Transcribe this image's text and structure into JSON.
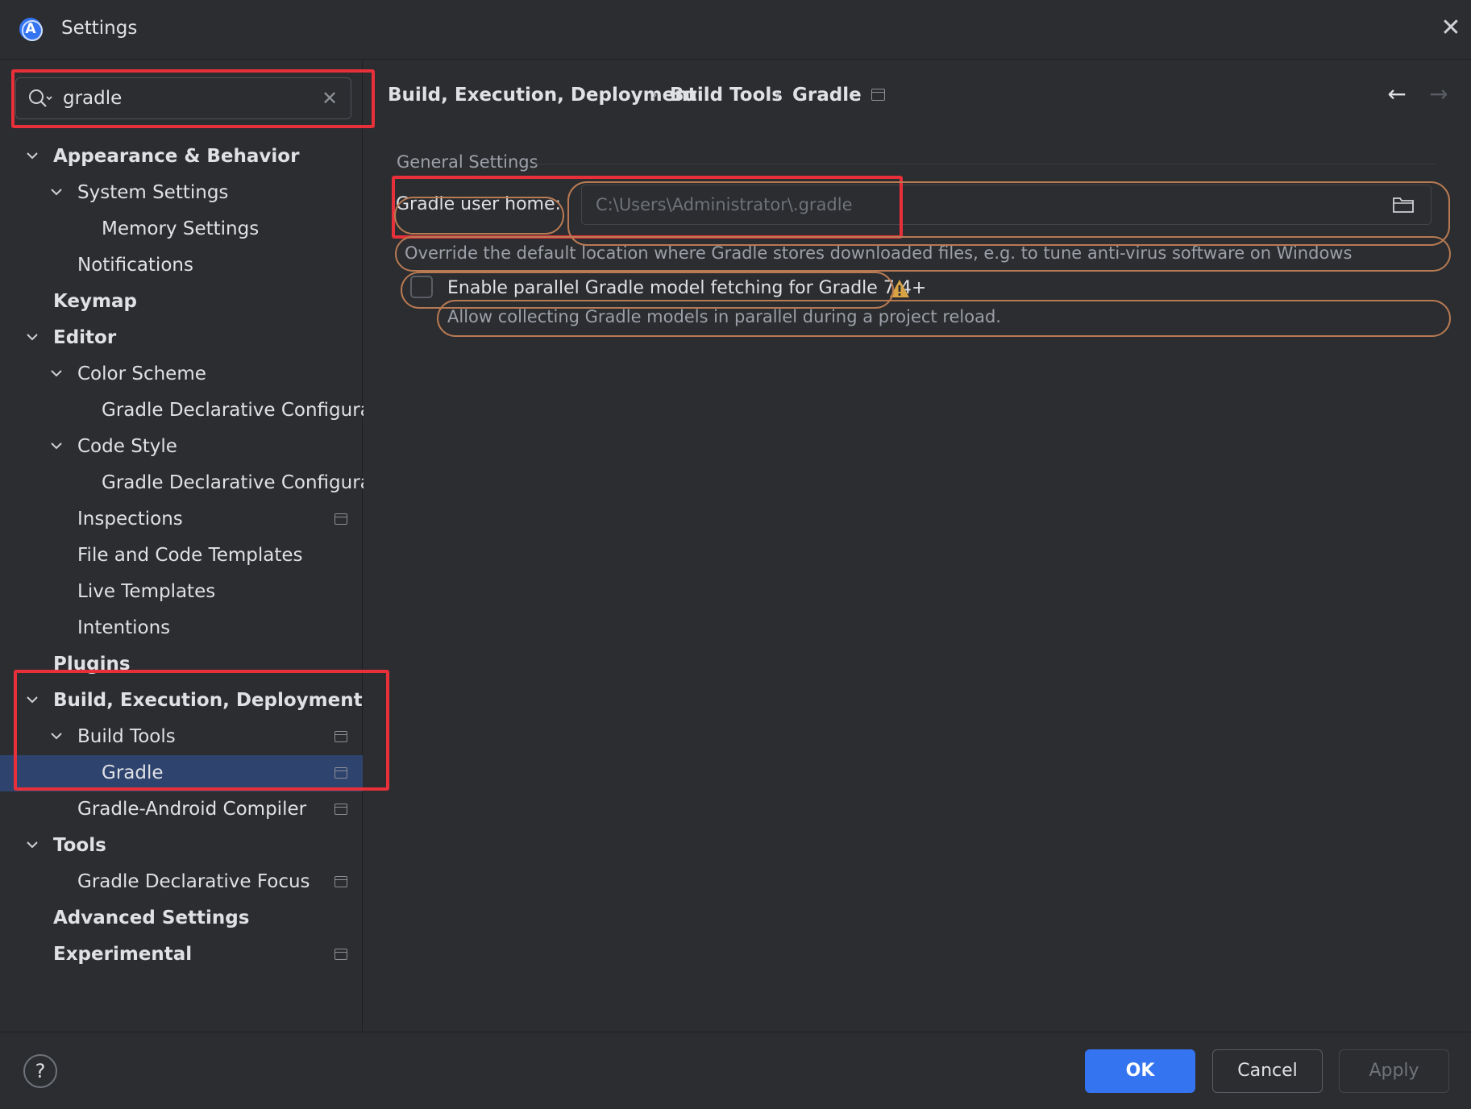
{
  "window": {
    "title": "Settings"
  },
  "search": {
    "value": "gradle"
  },
  "tree": [
    {
      "label": "Appearance & Behavior",
      "level": 0,
      "bold": true,
      "expanded": true,
      "has_chevron": true,
      "page_icon": false,
      "selected": false
    },
    {
      "label": "System Settings",
      "level": 1,
      "bold": false,
      "expanded": true,
      "has_chevron": true,
      "page_icon": false,
      "selected": false
    },
    {
      "label": "Memory Settings",
      "level": 2,
      "bold": false,
      "has_chevron": false,
      "page_icon": false,
      "selected": false
    },
    {
      "label": "Notifications",
      "level": 1,
      "bold": false,
      "has_chevron": false,
      "page_icon": false,
      "selected": false
    },
    {
      "label": "Keymap",
      "level": 0,
      "bold": true,
      "has_chevron": false,
      "page_icon": false,
      "selected": false
    },
    {
      "label": "Editor",
      "level": 0,
      "bold": true,
      "expanded": true,
      "has_chevron": true,
      "page_icon": false,
      "selected": false
    },
    {
      "label": "Color Scheme",
      "level": 1,
      "bold": false,
      "expanded": true,
      "has_chevron": true,
      "page_icon": false,
      "selected": false
    },
    {
      "label": "Gradle Declarative Configurati",
      "level": 2,
      "bold": false,
      "has_chevron": false,
      "page_icon": false,
      "selected": false
    },
    {
      "label": "Code Style",
      "level": 1,
      "bold": false,
      "expanded": true,
      "has_chevron": true,
      "page_icon": false,
      "selected": false
    },
    {
      "label": "Gradle Declarative Configurati",
      "level": 2,
      "bold": false,
      "has_chevron": false,
      "page_icon": false,
      "selected": false
    },
    {
      "label": "Inspections",
      "level": 1,
      "bold": false,
      "has_chevron": false,
      "page_icon": true,
      "selected": false
    },
    {
      "label": "File and Code Templates",
      "level": 1,
      "bold": false,
      "has_chevron": false,
      "page_icon": false,
      "selected": false
    },
    {
      "label": "Live Templates",
      "level": 1,
      "bold": false,
      "has_chevron": false,
      "page_icon": false,
      "selected": false
    },
    {
      "label": "Intentions",
      "level": 1,
      "bold": false,
      "has_chevron": false,
      "page_icon": false,
      "selected": false
    },
    {
      "label": "Plugins",
      "level": 0,
      "bold": true,
      "has_chevron": false,
      "page_icon": false,
      "selected": false
    },
    {
      "label": "Build, Execution, Deployment",
      "level": 0,
      "bold": true,
      "expanded": true,
      "has_chevron": true,
      "page_icon": false,
      "selected": false
    },
    {
      "label": "Build Tools",
      "level": 1,
      "bold": false,
      "expanded": true,
      "has_chevron": true,
      "page_icon": true,
      "selected": false
    },
    {
      "label": "Gradle",
      "level": 2,
      "bold": false,
      "has_chevron": false,
      "page_icon": true,
      "selected": true
    },
    {
      "label": "Gradle-Android Compiler",
      "level": 1,
      "bold": false,
      "has_chevron": false,
      "page_icon": true,
      "selected": false
    },
    {
      "label": "Tools",
      "level": 0,
      "bold": true,
      "expanded": true,
      "has_chevron": true,
      "page_icon": false,
      "selected": false
    },
    {
      "label": "Gradle Declarative Focus",
      "level": 1,
      "bold": false,
      "has_chevron": false,
      "page_icon": true,
      "selected": false
    },
    {
      "label": "Advanced Settings",
      "level": 0,
      "bold": true,
      "has_chevron": false,
      "page_icon": false,
      "selected": false
    },
    {
      "label": "Experimental",
      "level": 0,
      "bold": true,
      "has_chevron": false,
      "page_icon": true,
      "selected": false
    }
  ],
  "breadcrumb": [
    "Build, Execution, Deployment",
    "Build Tools",
    "Gradle"
  ],
  "content": {
    "section_title": "General Settings",
    "gradle_home_label": "Gradle user home:",
    "gradle_home_placeholder": "C:\\Users\\Administrator\\.gradle",
    "gradle_home_hint": "Override the default location where Gradle stores downloaded files, e.g. to tune anti-virus software on Windows",
    "parallel_label": "Enable parallel Gradle model fetching for Gradle 7.4+",
    "parallel_checked": false,
    "parallel_desc": "Allow collecting Gradle models in parallel during a project reload."
  },
  "footer": {
    "help_label": "?",
    "ok_label": "OK",
    "cancel_label": "Cancel",
    "apply_label": "Apply",
    "apply_enabled": false
  },
  "icons": {
    "app": "android-studio-icon",
    "close": "close-icon",
    "search": "search-icon",
    "clear": "clear-icon",
    "chevron": "chevron-down-icon",
    "page": "page-icon",
    "back": "arrow-left-icon",
    "forward": "arrow-right-icon",
    "folder": "folder-icon",
    "warning": "warning-icon",
    "help": "help-icon"
  },
  "colors": {
    "accent": "#3574f0",
    "selection": "#2e436e",
    "annotation_red": "#e8303a",
    "annotation_orange": "#b87a53",
    "warning": "#d9a343"
  }
}
